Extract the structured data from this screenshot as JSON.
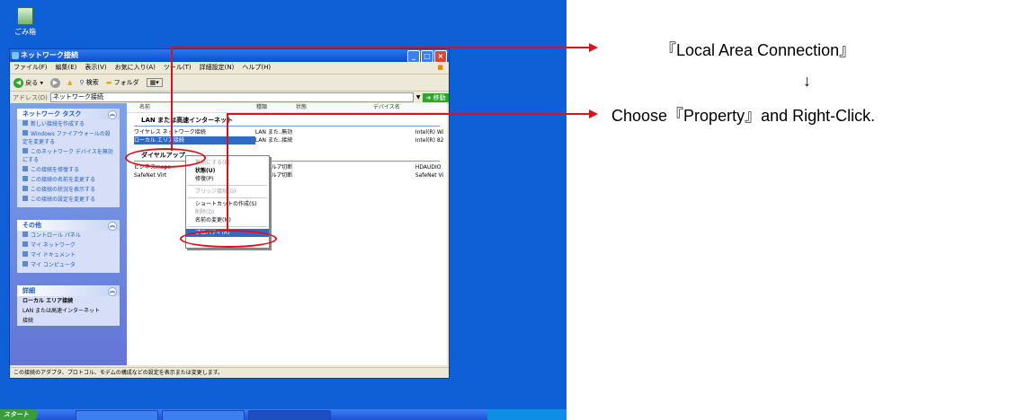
{
  "desktop": {
    "recycle_label": "ごみ箱"
  },
  "window": {
    "title": "ネットワーク接続",
    "menu": [
      "ファイル(F)",
      "編集(E)",
      "表示(V)",
      "お気に入り(A)",
      "ツール(T)",
      "詳細設定(N)",
      "ヘルプ(H)"
    ],
    "toolbar": {
      "back": "戻る",
      "search": "検索",
      "folders": "フォルダ"
    },
    "address_label": "アドレス(D)",
    "address_value": "ネットワーク接続",
    "go_label": "移動"
  },
  "left_pane": {
    "tasks_header": "ネットワーク タスク",
    "tasks": [
      "新しい接続を作成する",
      "Windows ファイアウォールの設定を変更する",
      "このネットワーク デバイスを無効にする",
      "この接続を修復する",
      "この接続の名前を変更する",
      "この接続の状況を表示する",
      "この接続の設定を変更する"
    ],
    "other_header": "その他",
    "other": [
      "コントロール パネル",
      "マイ ネットワーク",
      "マイ ドキュメント",
      "マイ コンピュータ"
    ],
    "details_header": "詳細",
    "details_title": "ローカル エリア接続",
    "details_lines": [
      "LAN または高速インターネット",
      "接続"
    ]
  },
  "right_pane": {
    "columns": [
      "名前",
      "種類",
      "状態",
      "デバイス名"
    ],
    "group_lan": "LAN または高速インターネット",
    "lan_rows": [
      {
        "name": "ワイヤレス ネットワーク接続",
        "type": "LAN また...",
        "status": "無効",
        "device": "Intel(R) Wi"
      },
      {
        "name": "ローカル エリア接続",
        "type": "LAN また...",
        "status": "接続",
        "device": "Intel(R) 82"
      }
    ],
    "group_dialup": "ダイヤルアップ",
    "dialup_rows": [
      {
        "name": "ビジネスmope",
        "type": "ダイヤルア...",
        "status": "切断",
        "device": "HDAUDIO"
      },
      {
        "name": "SafeNet Virt",
        "type": "ダイヤルア...",
        "status": "切断",
        "device": "SafeNet Vi"
      }
    ]
  },
  "context_menu": {
    "items": [
      "無効にする(B)",
      "状態(U)",
      "修復(P)",
      "ブリッジ接続(G)",
      "ショートカットの作成(S)",
      "削除(D)",
      "名前の変更(M)",
      "プロパティ(R)"
    ]
  },
  "status_bar": "この接続のアダプタ、プロトコル、モデムの構成などの設定を表示または変更します。",
  "taskbar": {
    "start": "スタート"
  },
  "annotations": {
    "line1": "『Local Area Connection』",
    "arrow": "↓",
    "line2": "Choose『Property』and Right-Click."
  },
  "colors": {
    "annotation_red": "#e0101a",
    "desktop_blue": "#0f5fd6"
  }
}
